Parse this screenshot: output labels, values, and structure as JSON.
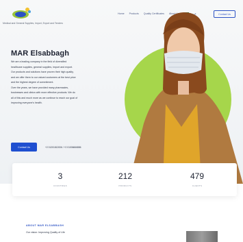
{
  "header": {
    "logo_subtitle": "Medical and General Supplies, Import, Export and Tenders",
    "nav": [
      "Home",
      "Products",
      "Quality Certificates",
      "About Us",
      "عربى"
    ],
    "contact_label": "Contact Us"
  },
  "hero": {
    "title": "MAR Elsabbagh",
    "description": [
      "We are a leading company in the field of diversified",
      "healthcare supplies, general supplies, import and export.",
      "Our products and solutions have proven their high quality,",
      "and we offer them to our valued customers at the best price",
      "and the highest degree of commitment.",
      "Over the years, we have provided many pharmacies,",
      "businesses and clinics with more effective products. We do",
      "all of this and much more as we continue to reach our goal of",
      "improving everyone's health."
    ],
    "cta_label": "Contact Us",
    "phones": "+2 01201812006 / +2 01006666886"
  },
  "stats": [
    {
      "value": "3",
      "label": "COUNTRIES"
    },
    {
      "value": "212",
      "label": "PRODUCTS"
    },
    {
      "value": "479",
      "label": "CLIENTS"
    }
  ],
  "about": {
    "label": "ABOUT MAR ELSABBAGH",
    "vision": "Our vision: Improving Quality of Life"
  },
  "colors": {
    "accent": "#1f4fd0",
    "figure_bg": "#a6d64b",
    "sweater": "#e0a52a"
  }
}
